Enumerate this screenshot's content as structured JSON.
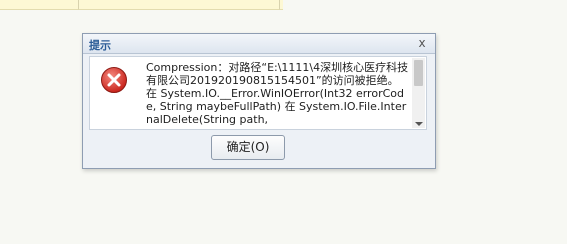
{
  "dialog": {
    "title": "提示",
    "close_glyph": "x",
    "message": "Compression：对路径“E:\\1111\\4深圳核心医疗科技有限公司201920190815154501”的访问被拒绝。\n在 System.IO.__Error.WinIOError(Int32 errorCode, String maybeFullPath) 在 System.IO.File.InternalDelete(String path,",
    "ok_label": "确定(O)",
    "icon": "error-icon"
  },
  "colors": {
    "title_text": "#2a5b96",
    "error_red": "#d9312a",
    "background": "#f7f8f3"
  }
}
